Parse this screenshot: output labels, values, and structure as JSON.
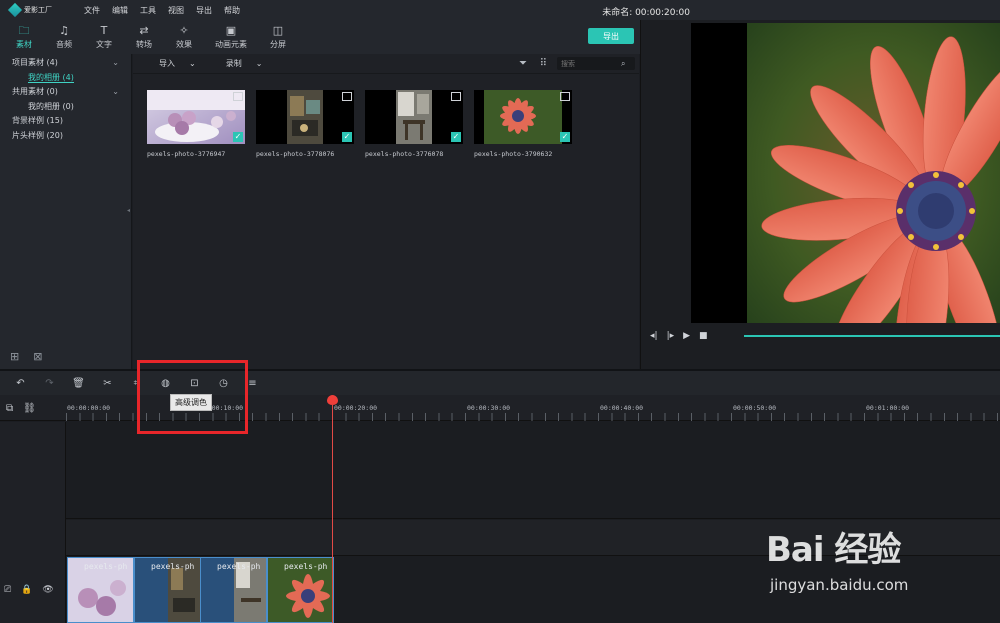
{
  "app": {
    "logo_text": "爱影工厂",
    "menu": [
      "文件",
      "编辑",
      "工具",
      "视图",
      "导出",
      "帮助"
    ],
    "project_name": "未命名: 00:00:20:00"
  },
  "tabs": [
    {
      "label": "素材",
      "icon": "folder-icon",
      "glyph": "🗀",
      "active": true
    },
    {
      "label": "音频",
      "icon": "music-icon",
      "glyph": "♫"
    },
    {
      "label": "文字",
      "icon": "text-icon",
      "glyph": "T"
    },
    {
      "label": "转场",
      "icon": "transition-icon",
      "glyph": "⇄"
    },
    {
      "label": "效果",
      "icon": "effects-icon",
      "glyph": "✧"
    },
    {
      "label": "动画元素",
      "icon": "image-icon",
      "glyph": "▣"
    },
    {
      "label": "分屏",
      "icon": "split-screen-icon",
      "glyph": "◫"
    }
  ],
  "export_label": "导出",
  "library": [
    {
      "label": "项目素材 (4)",
      "level": 0,
      "expand": true
    },
    {
      "label": "我的相册 (4)",
      "level": 1,
      "selected": true
    },
    {
      "label": "共用素材 (0)",
      "level": 0,
      "expand": true
    },
    {
      "label": "我的相册 (0)",
      "level": 1
    },
    {
      "label": "背景样例 (15)",
      "level": 0
    },
    {
      "label": "片头样例 (20)",
      "level": 0
    }
  ],
  "media_bar": {
    "import_label": "导入",
    "record_label": "录制",
    "search_placeholder": "搜索"
  },
  "media_items": [
    {
      "name": "pexels-photo-3776947"
    },
    {
      "name": "pexels-photo-3778076"
    },
    {
      "name": "pexels-photo-3776078"
    },
    {
      "name": "pexels-photo-3790632"
    }
  ],
  "ruler": {
    "timecodes": [
      "00:00:00:00",
      "00:00:10:00",
      "00:00:20:00",
      "00:00:30:00",
      "00:00:40:00",
      "00:00:50:00",
      "00:01:00:00"
    ]
  },
  "tooltip": "高级调色",
  "clips": [
    {
      "label": "pexels-ph"
    },
    {
      "label": "pexels-ph"
    },
    {
      "label": "pexels-ph"
    },
    {
      "label": "pexels-ph"
    }
  ],
  "watermark": {
    "text": "Bai 经验",
    "url": "jingyan.baidu.com"
  },
  "colors": {
    "accent": "#2bc5b4",
    "playhead": "#ef3f3a",
    "highlight": "#e8262a"
  }
}
